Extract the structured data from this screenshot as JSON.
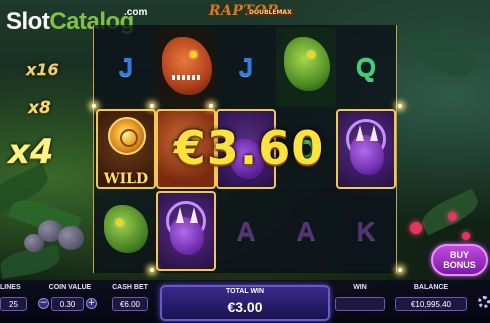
{
  "logo": {
    "slot": "Slot",
    "catalog": "Catalog",
    "com": ".com"
  },
  "game": {
    "title": "RAPTOR",
    "subtitle": "DOUBLEMAX"
  },
  "multipliers": [
    "x16",
    "x8",
    "x4"
  ],
  "reels": [
    [
      "J",
      "T-rex",
      "Wild",
      "Raptor"
    ],
    [
      "T-rex",
      "T-rex",
      "Triceratops"
    ],
    [
      "J",
      "Triceratops",
      "A"
    ],
    [
      "Raptor",
      "Q",
      "A"
    ],
    [
      "Q",
      "Triceratops",
      "K"
    ]
  ],
  "win_amount": "€3.60",
  "wild_label": "WILD",
  "bottom_bar": {
    "lines_label": "LINES",
    "lines_value": "25",
    "coin_label": "COIN VALUE",
    "coin_value": "0.30",
    "cash_bet_label": "CASH BET",
    "cash_bet_value": "€6.00",
    "total_win_label": "TOTAL WIN",
    "total_win_value": "€3.00",
    "win_label": "WIN",
    "win_value": "",
    "balance_label": "BALANCE",
    "balance_value": "€10,995.40",
    "minus": "−",
    "plus": "+"
  },
  "buy_bonus": {
    "line1": "BUY",
    "line2": "BONUS"
  },
  "colors": {
    "accent_gold": "#ffe23a",
    "reel_win": "#5a2e86",
    "brand_green": "#7dc242",
    "buy_bonus": "#c04ae0"
  },
  "icons": {
    "settings": "gear-icon"
  }
}
